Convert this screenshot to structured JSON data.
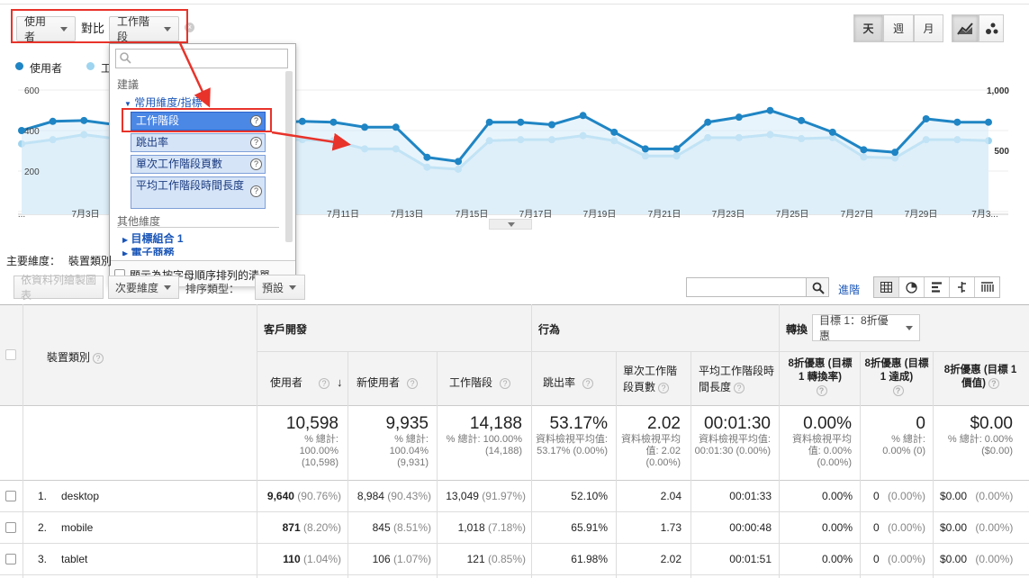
{
  "controls": {
    "metric1": "使用者",
    "versus": "對比",
    "metric2": "工作階段",
    "period_day": "天",
    "period_week": "週",
    "period_month": "月"
  },
  "legend": {
    "series1": "使用者",
    "series2": "工"
  },
  "chart_data": {
    "type": "line",
    "x_ticks": [
      "...",
      "7月3日",
      "7月11日",
      "7月13日",
      "7月15日",
      "7月17日",
      "7月19日",
      "7月21日",
      "7月23日",
      "7月25日",
      "7月27日",
      "7月29日",
      "7月3..."
    ],
    "left_axis_ticks": [
      "600",
      "400",
      "200"
    ],
    "right_axis_ticks": [
      "1,000",
      "500"
    ],
    "series": [
      {
        "name": "使用者",
        "axis": "left",
        "color": "#1f85c4",
        "values": [
          420,
          475,
          480,
          455,
          470,
          465,
          470,
          465,
          465,
          475,
          470,
          440,
          440,
          260,
          235,
          470,
          470,
          455,
          510,
          410,
          310,
          310,
          470,
          500,
          540,
          480,
          410,
          305,
          290,
          490,
          470,
          470
        ]
      },
      {
        "name": "工作階段",
        "axis": "right",
        "color": "#9ed4ef",
        "values": [
          560,
          600,
          650,
          610,
          620,
          610,
          620,
          600,
          600,
          600,
          590,
          510,
          510,
          330,
          310,
          590,
          600,
          600,
          640,
          590,
          440,
          440,
          620,
          620,
          650,
          610,
          620,
          430,
          420,
          600,
          600,
          590
        ]
      }
    ],
    "left_ylim": [
      0,
      700
    ],
    "right_ylim": [
      0,
      1150
    ]
  },
  "dropdown": {
    "suggest_label": "建議",
    "common_group": "常用維度/指標",
    "items": [
      "工作階段",
      "跳出率",
      "單次工作階段頁數",
      "平均工作階段時間長度"
    ],
    "other_label": "其他維度",
    "group_goal": "目標組合 1",
    "group_ecom": "電子商務",
    "sort_checkbox": "顯示為按字母順序排列的清單"
  },
  "toolbar": {
    "primary_dim_label": "主要維度：",
    "primary_dim_value": "裝置類別",
    "plot_rows": "依資料列繪製圖表",
    "secondary_dim": "次要維度",
    "sort_type": "排序類型：",
    "sort_default": "預設",
    "advanced": "進階"
  },
  "table": {
    "col_device": "裝置類別",
    "group_acquisition": "客戶開發",
    "group_behavior": "行為",
    "group_conversion": "轉換",
    "goal_select": "目標 1：8折優惠",
    "headers": {
      "users": "使用者",
      "new_users": "新使用者",
      "sessions": "工作階段",
      "bounce": "跳出率",
      "pages": "單次工作階段頁數",
      "duration": "平均工作階段時間長度",
      "conv_rate": "8折優惠 (目標 1 轉換率)",
      "completions": "8折優惠 (目標 1 達成)",
      "value": "8折優惠 (目標 1 價值)"
    },
    "totals": {
      "users": "10,598",
      "users_sub": "% 總計: 100.00% (10,598)",
      "new_users": "9,935",
      "new_users_sub": "% 總計: 100.04% (9,931)",
      "sessions": "14,188",
      "sessions_sub": "% 總計: 100.00% (14,188)",
      "bounce": "53.17%",
      "bounce_sub": "資料檢視平均值: 53.17% (0.00%)",
      "pages": "2.02",
      "pages_sub": "資料檢視平均值: 2.02 (0.00%)",
      "duration": "00:01:30",
      "duration_sub": "資料檢視平均值: 00:01:30 (0.00%)",
      "conv_rate": "0.00%",
      "conv_rate_sub": "資料檢視平均值: 0.00% (0.00%)",
      "completions": "0",
      "completions_sub": "% 總計: 0.00% (0)",
      "value": "$0.00",
      "value_sub": "% 總計: 0.00% ($0.00)"
    },
    "rows": [
      {
        "idx": "1.",
        "device": "desktop",
        "users": "9,640",
        "users_pct": "(90.76%)",
        "new_users": "8,984",
        "new_pct": "(90.43%)",
        "sessions": "13,049",
        "sess_pct": "(91.97%)",
        "bounce": "52.10%",
        "pages": "2.04",
        "duration": "00:01:33",
        "conv": "0.00%",
        "comp": "0",
        "comp_pct": "(0.00%)",
        "value": "$0.00",
        "value_pct": "(0.00%)"
      },
      {
        "idx": "2.",
        "device": "mobile",
        "users": "871",
        "users_pct": "(8.20%)",
        "new_users": "845",
        "new_pct": "(8.51%)",
        "sessions": "1,018",
        "sess_pct": "(7.18%)",
        "bounce": "65.91%",
        "pages": "1.73",
        "duration": "00:00:48",
        "conv": "0.00%",
        "comp": "0",
        "comp_pct": "(0.00%)",
        "value": "$0.00",
        "value_pct": "(0.00%)"
      },
      {
        "idx": "3.",
        "device": "tablet",
        "users": "110",
        "users_pct": "(1.04%)",
        "new_users": "106",
        "new_pct": "(1.07%)",
        "sessions": "121",
        "sess_pct": "(0.85%)",
        "bounce": "61.98%",
        "pages": "2.02",
        "duration": "00:01:51",
        "conv": "0.00%",
        "comp": "0",
        "comp_pct": "(0.00%)",
        "value": "$0.00",
        "value_pct": "(0.00%)"
      }
    ]
  },
  "colors": {
    "accent": "#e8332a",
    "series1": "#1f85c4",
    "series2": "#9ed4ef",
    "link": "#1a56b8"
  }
}
